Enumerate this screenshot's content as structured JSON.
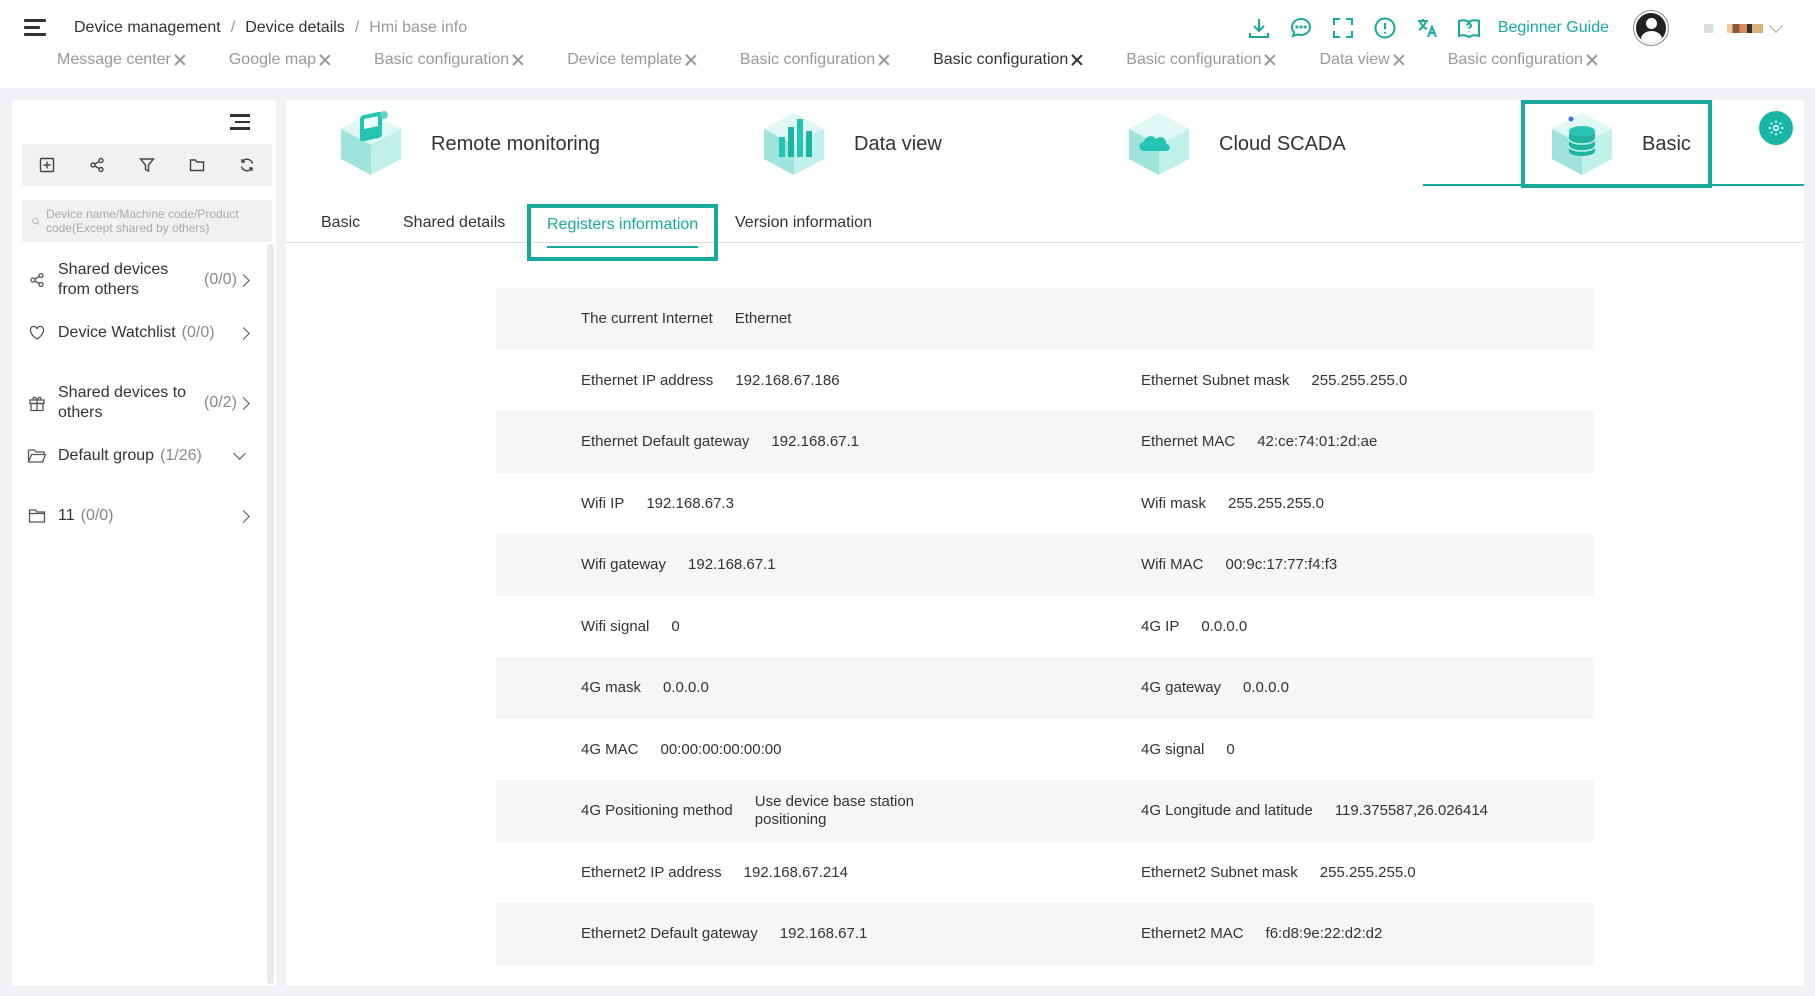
{
  "breadcrumb": [
    "Device management",
    "Device details",
    "Hmi base info"
  ],
  "open_tabs": [
    {
      "label": "Message center",
      "active": false
    },
    {
      "label": "Google map",
      "active": false
    },
    {
      "label": "Basic configuration",
      "active": false
    },
    {
      "label": "Device template",
      "active": false
    },
    {
      "label": "Basic configuration",
      "active": false
    },
    {
      "label": "Basic configuration",
      "active": true
    },
    {
      "label": "Basic configuration",
      "active": false
    },
    {
      "label": "Data view",
      "active": false
    },
    {
      "label": "Basic configuration",
      "active": false
    }
  ],
  "header_tools": [
    "download-icon",
    "chat-icon",
    "fullscreen-icon",
    "info-icon",
    "translate-icon",
    "guide-book-icon"
  ],
  "beginner_guide": "Beginner Guide",
  "accent_color": "#17a99e",
  "sidebar": {
    "toolbar_icons": [
      "add-icon",
      "share-icon",
      "filter-icon",
      "folder-icon",
      "refresh-icon"
    ],
    "search_placeholder": "Device name/Machine code/Product code(Except shared by others)",
    "items": [
      {
        "label": "Shared devices from others",
        "count": "(0/0)"
      },
      {
        "label": "Device Watchlist",
        "count": "(0/0)"
      },
      {
        "label": "Shared devices to others",
        "count": "(0/2)"
      },
      {
        "label": "Default group",
        "count": "(1/26)"
      },
      {
        "label": "11",
        "count": "(0/0)"
      }
    ]
  },
  "modules": [
    {
      "label": "Remote monitoring"
    },
    {
      "label": "Data view"
    },
    {
      "label": "Cloud SCADA"
    },
    {
      "label": "Basic"
    }
  ],
  "subtabs": [
    "Basic",
    "Shared details",
    "Registers information",
    "Version information"
  ],
  "registers": [
    {
      "left": {
        "k": "The current Internet",
        "v": "Ethernet"
      },
      "right": null
    },
    {
      "left": {
        "k": "Ethernet IP address",
        "v": "192.168.67.186"
      },
      "right": {
        "k": "Ethernet Subnet mask",
        "v": "255.255.255.0"
      }
    },
    {
      "left": {
        "k": "Ethernet Default gateway",
        "v": "192.168.67.1"
      },
      "right": {
        "k": "Ethernet MAC",
        "v": "42:ce:74:01:2d:ae"
      }
    },
    {
      "left": {
        "k": "Wifi IP",
        "v": "192.168.67.3"
      },
      "right": {
        "k": "Wifi mask",
        "v": "255.255.255.0"
      }
    },
    {
      "left": {
        "k": "Wifi gateway",
        "v": "192.168.67.1"
      },
      "right": {
        "k": "Wifi MAC",
        "v": "00:9c:17:77:f4:f3"
      }
    },
    {
      "left": {
        "k": "Wifi signal",
        "v": "0"
      },
      "right": {
        "k": "4G IP",
        "v": "0.0.0.0"
      }
    },
    {
      "left": {
        "k": "4G mask",
        "v": "0.0.0.0"
      },
      "right": {
        "k": "4G gateway",
        "v": "0.0.0.0"
      }
    },
    {
      "left": {
        "k": "4G MAC",
        "v": "00:00:00:00:00:00"
      },
      "right": {
        "k": "4G signal",
        "v": "0"
      }
    },
    {
      "left": {
        "k": "4G Positioning method",
        "v": "Use device base station positioning"
      },
      "right": {
        "k": "4G Longitude and latitude",
        "v": "119.375587,26.026414"
      }
    },
    {
      "left": {
        "k": "Ethernet2 IP address",
        "v": "192.168.67.214"
      },
      "right": {
        "k": "Ethernet2 Subnet mask",
        "v": "255.255.255.0"
      }
    },
    {
      "left": {
        "k": "Ethernet2 Default gateway",
        "v": "192.168.67.1"
      },
      "right": {
        "k": "Ethernet2 MAC",
        "v": "f6:d8:9e:22:d2:d2"
      }
    }
  ]
}
